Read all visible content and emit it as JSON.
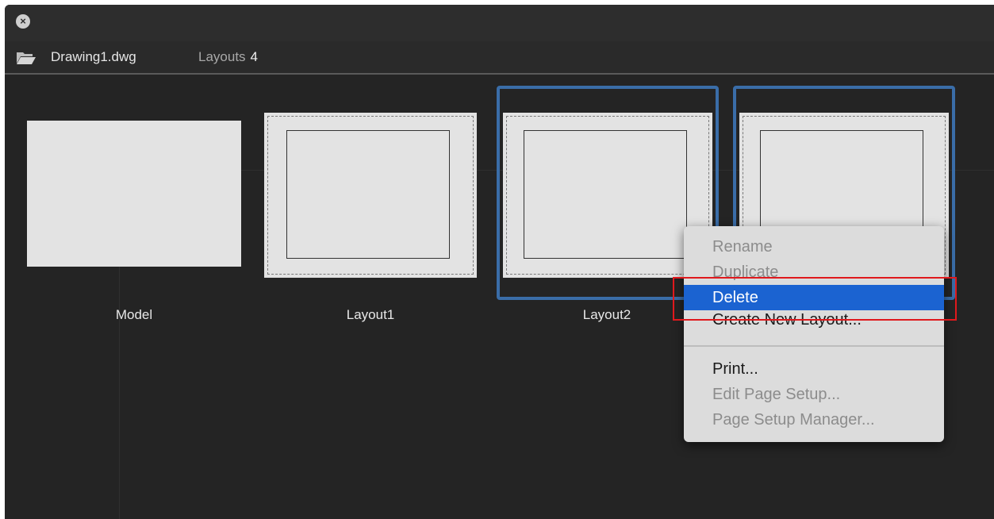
{
  "toolbar": {
    "filename": "Drawing1.dwg",
    "layouts_label": "Layouts",
    "layouts_count": "4"
  },
  "thumbnails": [
    {
      "label": "Model"
    },
    {
      "label": "Layout1"
    },
    {
      "label": "Layout2"
    }
  ],
  "context_menu": {
    "items": [
      {
        "label": "Rename",
        "state": "disabled"
      },
      {
        "label": "Duplicate",
        "state": "disabled"
      },
      {
        "label": "Delete",
        "state": "active"
      },
      {
        "label": "Create New Layout...",
        "state": "enabled"
      },
      {
        "label": "Print...",
        "state": "enabled"
      },
      {
        "label": "Edit Page Setup...",
        "state": "disabled"
      },
      {
        "label": "Page Setup Manager...",
        "state": "disabled"
      }
    ]
  },
  "colors": {
    "selection_border": "#3a6da8",
    "menu_highlight": "#1b63d1",
    "annotation_box": "#e0191d"
  },
  "icons": {
    "close": "close-icon",
    "folder": "folder-open-icon"
  }
}
